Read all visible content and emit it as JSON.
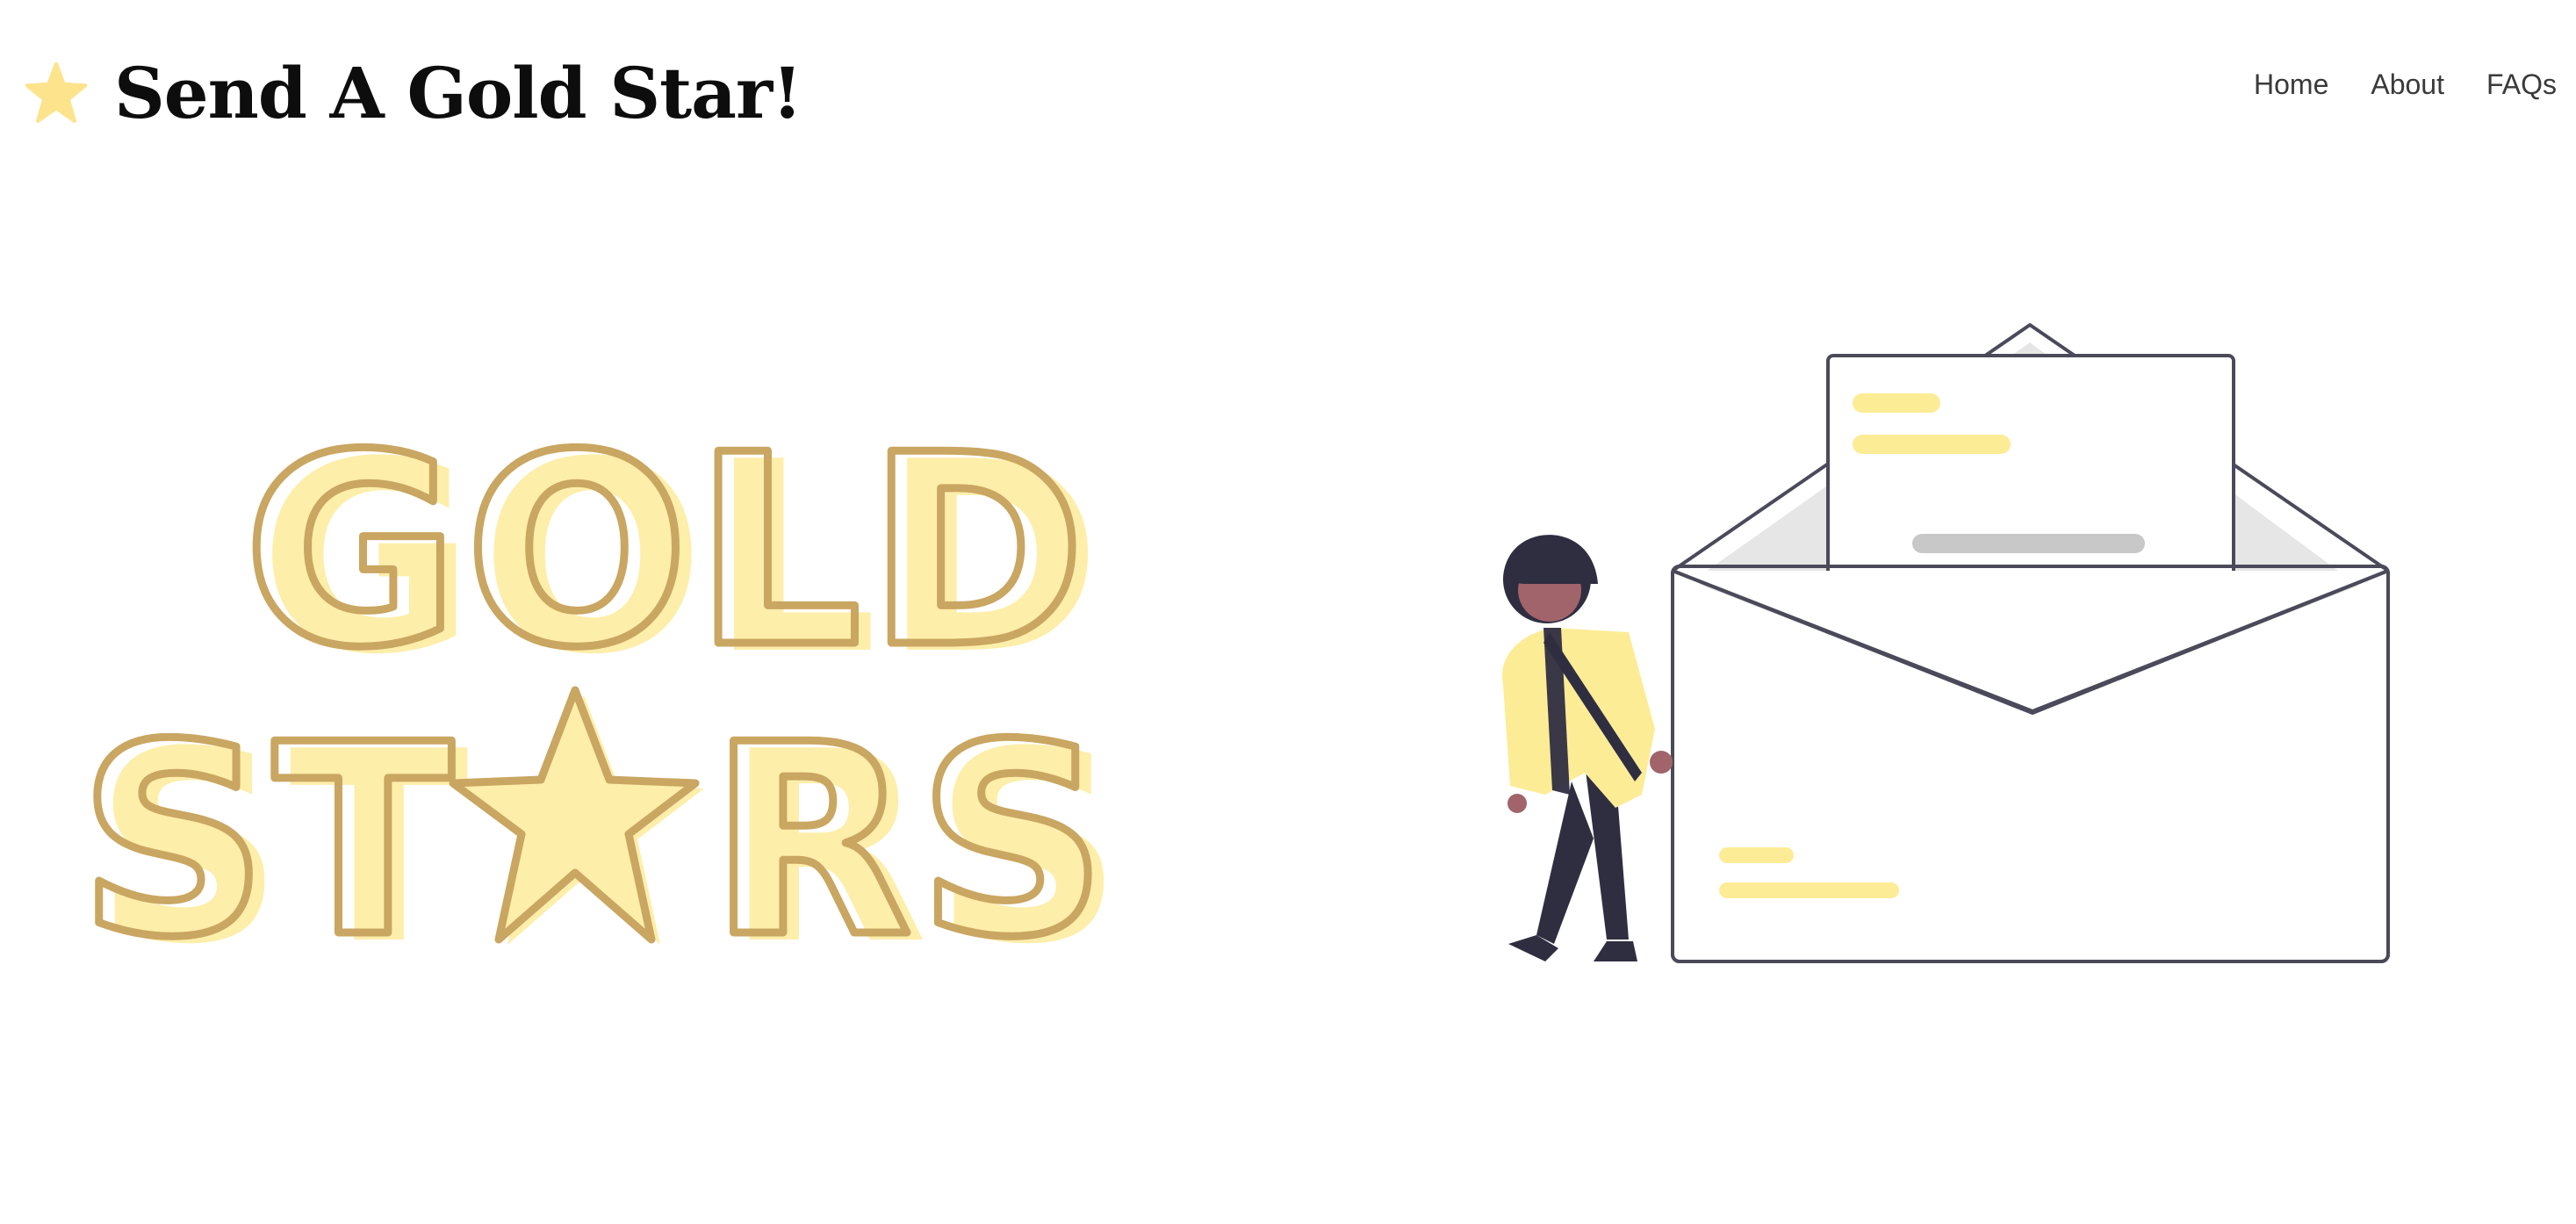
{
  "site": {
    "title": "Send A Gold Star!",
    "brand_icon": "star-icon"
  },
  "nav": {
    "items": [
      {
        "label": "Home"
      },
      {
        "label": "About"
      },
      {
        "label": "FAQs"
      }
    ]
  },
  "hero": {
    "line1": "GOLD",
    "line2_left": "ST",
    "line2_right": "RS",
    "center_icon": "star-icon",
    "illustration": "person-with-envelope-illustration"
  },
  "colors": {
    "gold_fill": "#FDEEAA",
    "gold_outline": "#C9A661",
    "star_yellow": "#FDE48C",
    "ink": "#0d0d0d",
    "nav_text": "#3a3a3a",
    "envelope_stroke": "#4a4a5a",
    "shadow_gray": "#E6E6E6",
    "line_gray": "#C8C8C8",
    "highlight_yellow": "#FDEC96",
    "skin": "#A0646A",
    "dark_navy": "#2F2E41"
  }
}
